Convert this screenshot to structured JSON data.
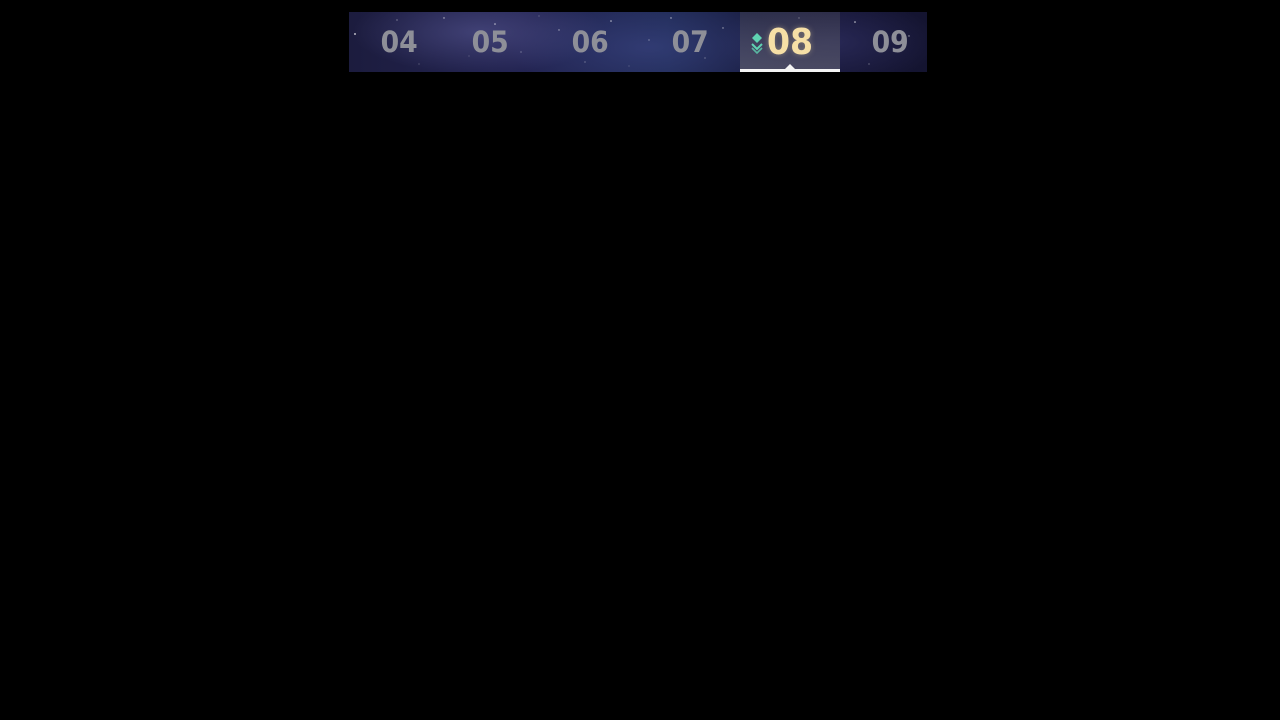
{
  "level_selector": {
    "tabs": [
      {
        "label": "04",
        "selected": false
      },
      {
        "label": "05",
        "selected": false
      },
      {
        "label": "06",
        "selected": false
      },
      {
        "label": "07",
        "selected": false
      },
      {
        "label": "08",
        "selected": true
      },
      {
        "label": "09",
        "selected": false
      }
    ],
    "selected_icon": "rank-diamond-chevron-icon",
    "colors": {
      "background": "#000000",
      "selected_text": "#f6dfa6",
      "unselected_text": "#8e8f98",
      "icon_accent": "#5fd3b2",
      "underline": "#f4f4f4"
    }
  }
}
